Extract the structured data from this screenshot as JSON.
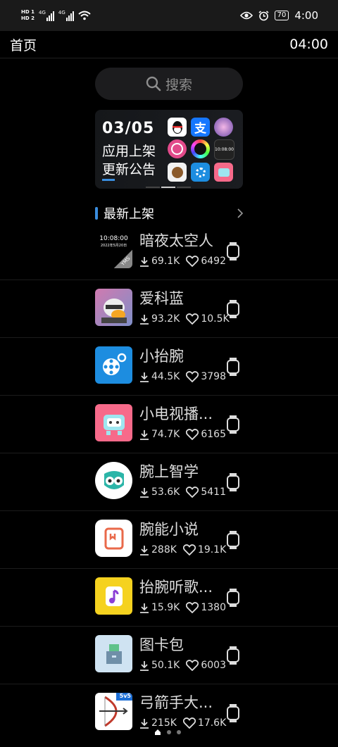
{
  "status_bar": {
    "hd1": "HD 1",
    "hd2": "HD 2",
    "net1": "4G",
    "net2": "4G",
    "battery": "70",
    "time": "4:00"
  },
  "top_bar": {
    "title": "首页",
    "time": "04:00"
  },
  "search": {
    "placeholder": "搜索"
  },
  "banner": {
    "date": "03/05",
    "line1": "应用上架",
    "line2": "更新公告"
  },
  "section": {
    "title": "最新上架"
  },
  "apps": [
    {
      "name": "暗夜太空人",
      "downloads": "69.1K",
      "likes": "6492"
    },
    {
      "name": "爱科蓝",
      "downloads": "93.2K",
      "likes": "10.5K"
    },
    {
      "name": "小抬腕",
      "downloads": "44.5K",
      "likes": "3798"
    },
    {
      "name": "小电视播...",
      "downloads": "74.7K",
      "likes": "6165"
    },
    {
      "name": "腕上智学",
      "downloads": "53.6K",
      "likes": "5411"
    },
    {
      "name": "腕能小说",
      "downloads": "288K",
      "likes": "19.1K"
    },
    {
      "name": "抬腕听歌...",
      "downloads": "15.9K",
      "likes": "1380"
    },
    {
      "name": "图卡包",
      "downloads": "50.1K",
      "likes": "6003"
    },
    {
      "name": "弓箭手大...",
      "downloads": "215K",
      "likes": "17.6K"
    }
  ],
  "icon_text": {
    "watchface_time": "10:08:00",
    "watchface_date": "2022年5月20日",
    "watchface_tag": "YMS",
    "archer_tag": "5v5"
  },
  "colors": {
    "accent": "#3a8dde",
    "background": "#000000"
  }
}
